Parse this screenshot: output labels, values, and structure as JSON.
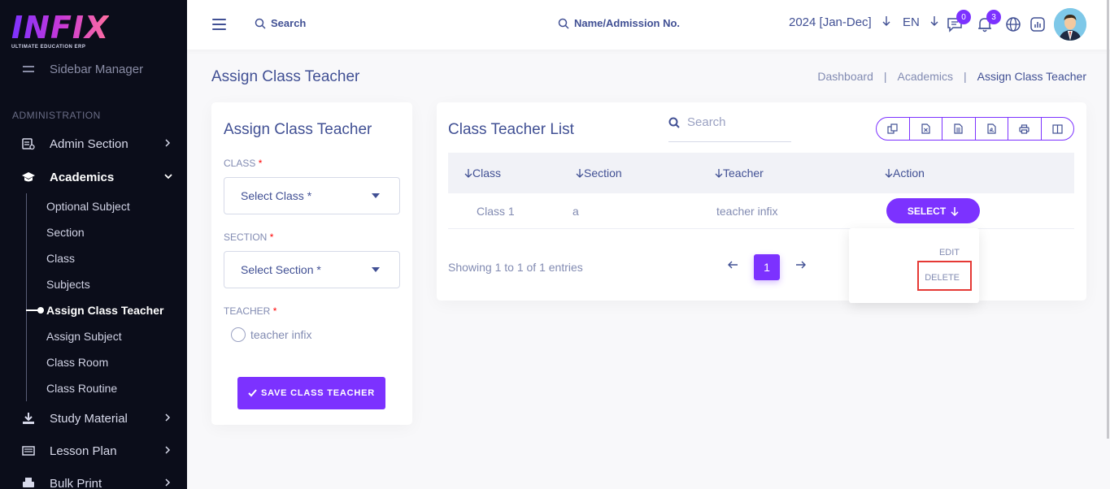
{
  "logo": {
    "text": "INFIX",
    "subtitle": "ULTIMATE EDUCATION ERP"
  },
  "sidebar": {
    "top_item": "Sidebar Manager",
    "heading": "ADMINISTRATION",
    "items": [
      {
        "label": "Admin Section"
      },
      {
        "label": "Academics"
      },
      {
        "label": "Study Material"
      },
      {
        "label": "Lesson Plan"
      },
      {
        "label": "Bulk Print"
      }
    ],
    "academics_sub": [
      {
        "label": "Optional Subject"
      },
      {
        "label": "Section"
      },
      {
        "label": "Class"
      },
      {
        "label": "Subjects"
      },
      {
        "label": "Assign Class Teacher"
      },
      {
        "label": "Assign Subject"
      },
      {
        "label": "Class Room"
      },
      {
        "label": "Class Routine"
      }
    ]
  },
  "header": {
    "search_label": "Search",
    "name_search_label": "Name/Admission No.",
    "session": "2024 [Jan-Dec]",
    "language": "EN",
    "chat_badge": "0",
    "notification_badge": "3"
  },
  "page": {
    "title": "Assign Class Teacher",
    "breadcrumb": [
      "Dashboard",
      "Academics",
      "Assign Class Teacher"
    ]
  },
  "form": {
    "title": "Assign Class Teacher",
    "class_label": "CLASS",
    "class_placeholder": "Select Class *",
    "section_label": "SECTION",
    "section_placeholder": "Select Section *",
    "teacher_label": "TEACHER",
    "teacher_option": "teacher infix",
    "required_mark": "*",
    "save_button": "SAVE CLASS TEACHER"
  },
  "table": {
    "title": "Class Teacher List",
    "search_placeholder": "Search",
    "columns": [
      "Class",
      "Section",
      "Teacher",
      "Action"
    ],
    "rows": [
      {
        "class": "Class 1",
        "section": "a",
        "teacher": "teacher infix",
        "action": "SELECT"
      }
    ],
    "showing": "Showing 1 to 1 of 1 entries",
    "current_page": "1",
    "export_icons": [
      "copy-icon",
      "excel-icon",
      "csv-icon",
      "pdf-icon",
      "print-icon",
      "columns-icon"
    ]
  },
  "dropdown": {
    "edit": "EDIT",
    "delete": "DELETE"
  },
  "colors": {
    "accent": "#7c32ff",
    "sidebar_bg": "#0b0d1a",
    "text": "#415094",
    "muted": "#828bb2",
    "highlight": "#e53935"
  }
}
